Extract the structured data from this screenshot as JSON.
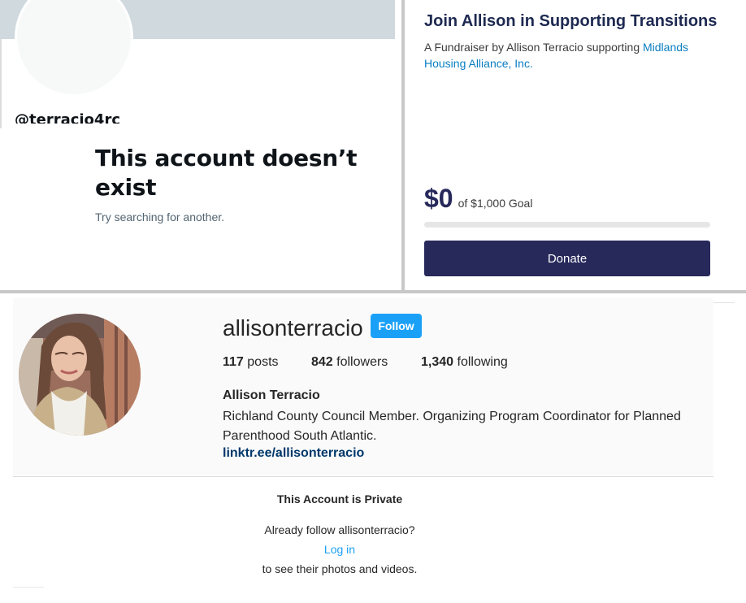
{
  "twitter": {
    "handle": "@terracio4rc",
    "title": "This account doesn’t exist",
    "subtitle": "Try searching for another."
  },
  "fundraiser": {
    "title": "Join Allison in Supporting Transitions",
    "by_text": "A Fundraiser by Allison Terracio supporting ",
    "org_link": "Midlands Housing Alliance, Inc.",
    "amount": "$0",
    "goal": "of $1,000 Goal",
    "progress_fraction": 0,
    "donate_label": "Donate",
    "colors": {
      "brand": "#27295b",
      "link": "#0a7ec2"
    }
  },
  "instagram": {
    "username": "allisonterracio",
    "follow_label": "Follow",
    "stats": [
      {
        "count": "117",
        "label": "posts"
      },
      {
        "count": "842",
        "label": "followers"
      },
      {
        "count": "1,340",
        "label": "following"
      }
    ],
    "name": "Allison Terracio",
    "bio": "Richland County Council Member. Organizing Program Coordinator for Planned Parenthood South Atlantic.",
    "link": "linktr.ee/allisonterracio",
    "private_heading": "This Account is Private",
    "already_follow": "Already follow allisonterracio?",
    "login_label": "Log in",
    "see_text": "to see their photos and videos.",
    "colors": {
      "follow_button": "#1aa1f7",
      "link": "#00376b"
    }
  }
}
